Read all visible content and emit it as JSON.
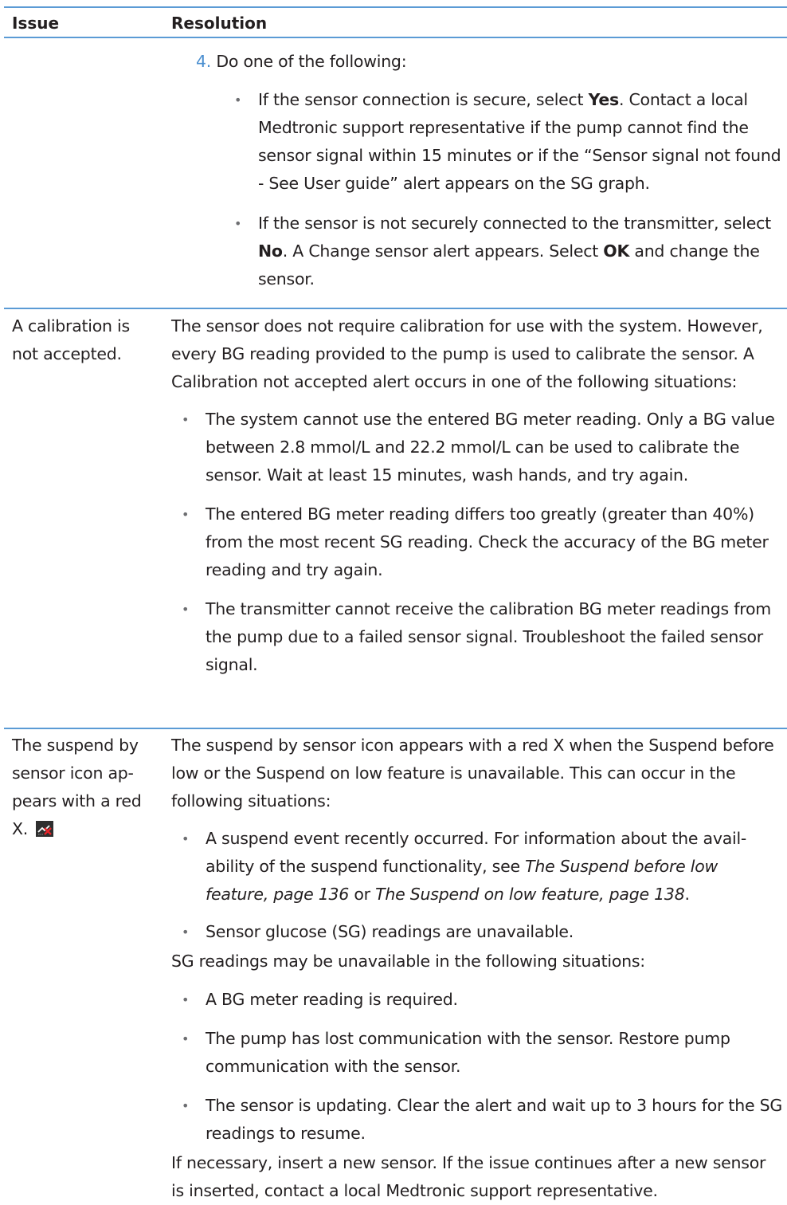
{
  "table": {
    "headers": {
      "issue": "Issue",
      "resolution": "Resolution"
    },
    "row_continuation": {
      "step_number": "4.",
      "step_text": "Do one of the following:",
      "bullet1": {
        "pre": "If the sensor connection is secure, select ",
        "bold": "Yes",
        "post": ". Contact a local Medtronic support representative if the pump cannot find the sensor signal within 15 minutes or if the “Sensor signal not found - See User guide” alert appears on the SG graph."
      },
      "bullet2": {
        "pre": "If the sensor is not securely connected to the transmitter, select ",
        "bold1": "No",
        "mid": ". A Change sensor alert appears. Select ",
        "bold2": "OK",
        "post": " and change the sensor."
      }
    },
    "row_calibration": {
      "issue": "A calibration is not accepted.",
      "intro": "The sensor does not require calibration for use with the system. However, every BG reading provided to the pump is used to calibrate the sensor. A Calibration not accepted alert occurs in one of the following situations:",
      "bullets": [
        "The system cannot use the entered BG meter reading. Only a BG value between 2.8 mmol/L and 22.2 mmol/L can be used to calibrate the sensor. Wait at least 15 minutes, wash hands, and try again.",
        "The entered BG meter reading differs too greatly (greater than 40%) from the most recent SG reading. Check the accuracy of the BG meter reading and try again.",
        "The transmitter cannot receive the calibration BG meter readings from the pump due to a failed sensor signal. Troubleshoot the failed sensor signal."
      ]
    },
    "row_suspend": {
      "issue": "The suspend by sensor icon ap-pears with a red X.",
      "intro": "The suspend by sensor icon appears with a red X when the Suspend before low or the Suspend on low feature is unavailable. This can occur in the following situations:",
      "bullet1": {
        "pre": "A suspend event recently occurred. For information about the avail-ability of the suspend functionality, see ",
        "ref1": "The Suspend before low feature, page 136",
        "mid": " or ",
        "ref2": "The Suspend on low feature, page 138",
        "post": "."
      },
      "bullet2": "Sensor glucose (SG) readings are unavailable.",
      "sub_intro": "SG readings may be unavailable in the following situations:",
      "sub_bullets": [
        "A BG meter reading is required.",
        "The pump has lost communication with the sensor. Restore pump communication with the sensor.",
        "The sensor is updating. Clear the alert and wait up to 3 hours for the SG readings to resume."
      ],
      "outro": "If necessary, insert a new sensor. If the issue continues after a new sensor is inserted, contact a local Medtronic support representative."
    },
    "icons": {
      "suspend_icon": "suspend-by-sensor-unavailable-icon",
      "accent_color": "#5b9bd5",
      "x_color": "#e8242a"
    }
  }
}
